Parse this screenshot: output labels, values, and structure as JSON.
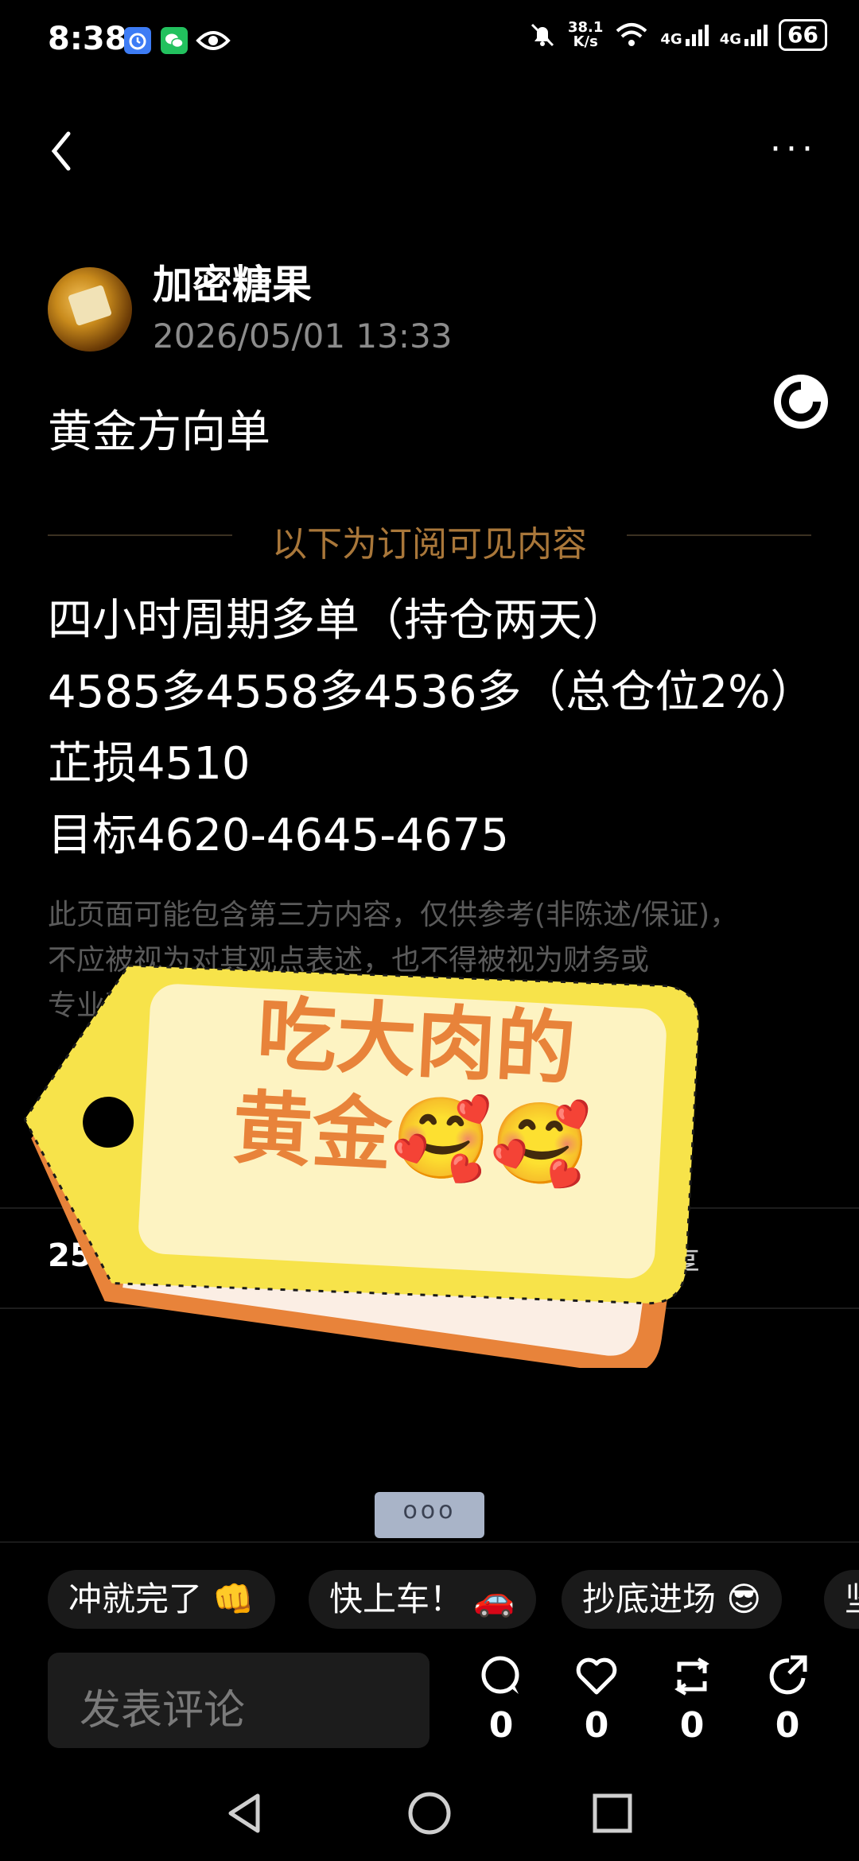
{
  "status_bar": {
    "time": "8:38",
    "network_speed_value": "38.1",
    "network_speed_unit": "K/s",
    "signal1": "4G",
    "signal2": "4G",
    "battery": "66",
    "icons": [
      "alarm-icon",
      "wechat-icon",
      "eye-icon",
      "mute-bell-icon",
      "wifi-icon",
      "signal-icon",
      "battery-icon"
    ]
  },
  "header": {
    "back_icon": "back-chevron-icon",
    "more_label": "···"
  },
  "post": {
    "author": "加密糖果",
    "time": "2026/05/01 13:33",
    "title": "黄金方向单",
    "subscriber_divider": "以下为订阅可见内容",
    "lines": [
      "四小时周期多单（持仓两天）",
      "4585多4558多4536多（总仓位2%）",
      "芷损4510",
      "目标4620-4645-4675"
    ],
    "disclaimer_line1": "此页面可能包含第三方内容，仅供参考(非陈述/保证)，",
    "disclaimer_line2": "不应被视",
    "disclaimer_line2b": "为",
    "disclaimer_line2c": "对",
    "disclaimer_line2d": "其观点表述，也不得被视为财务或",
    "disclaimer_line3": "专业建"
  },
  "sticker": {
    "line1": "吃大肉的",
    "line2": "黄金🥰🥰"
  },
  "stats": {
    "count_visible": "2528",
    "share_visible": "分享"
  },
  "more_handle": "ooo",
  "chips": [
    {
      "label": "冲就完了 👊"
    },
    {
      "label": "快上车！ 🚗"
    },
    {
      "label": "抄底进场 😎"
    },
    {
      "label": "坚"
    }
  ],
  "comment": {
    "placeholder": "发表评论"
  },
  "actions": [
    {
      "icon": "comment-icon",
      "count": "0"
    },
    {
      "icon": "heart-icon",
      "count": "0"
    },
    {
      "icon": "repost-icon",
      "count": "0"
    },
    {
      "icon": "share-icon",
      "count": "0"
    }
  ],
  "colors": {
    "background": "#000000",
    "subscriber_accent": "#a9773a",
    "sticker_yellow": "#f7e34a",
    "sticker_text": "#e8833a"
  }
}
